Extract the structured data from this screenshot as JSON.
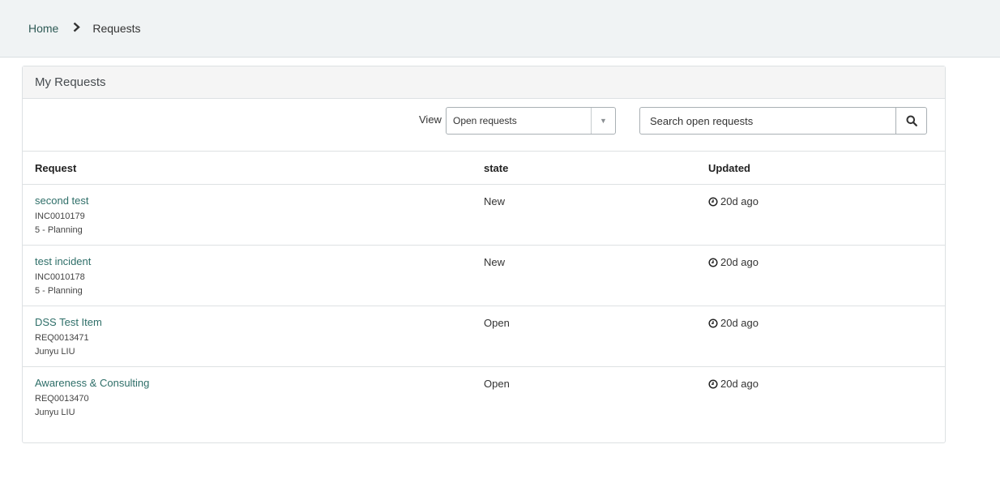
{
  "breadcrumb": {
    "home": "Home",
    "current": "Requests"
  },
  "panel": {
    "title": "My Requests"
  },
  "toolbar": {
    "view_label": "View",
    "view_selected": "Open requests",
    "search_placeholder": "Search open requests"
  },
  "table": {
    "headers": {
      "request": "Request",
      "state": "state",
      "updated": "Updated"
    },
    "rows": [
      {
        "title": "second test",
        "number": "INC0010179",
        "sub": "5 - Planning",
        "state": "New",
        "updated": "20d ago"
      },
      {
        "title": "test incident",
        "number": "INC0010178",
        "sub": "5 - Planning",
        "state": "New",
        "updated": "20d ago"
      },
      {
        "title": "DSS Test Item",
        "number": "REQ0013471",
        "sub": "Junyu LIU",
        "state": "Open",
        "updated": "20d ago"
      },
      {
        "title": "Awareness & Consulting",
        "number": "REQ0013470",
        "sub": "Junyu LIU",
        "state": "Open",
        "updated": "20d ago"
      }
    ]
  },
  "icons": {
    "breadcrumb_separator": "chevron-right-icon",
    "select_arrow": "caret-down-icon",
    "search": "search-icon",
    "updated": "clock-icon"
  },
  "colors": {
    "link": "#2e6e68",
    "topbar_bg": "#f0f3f4",
    "panel_heading_bg": "#f5f5f5"
  }
}
